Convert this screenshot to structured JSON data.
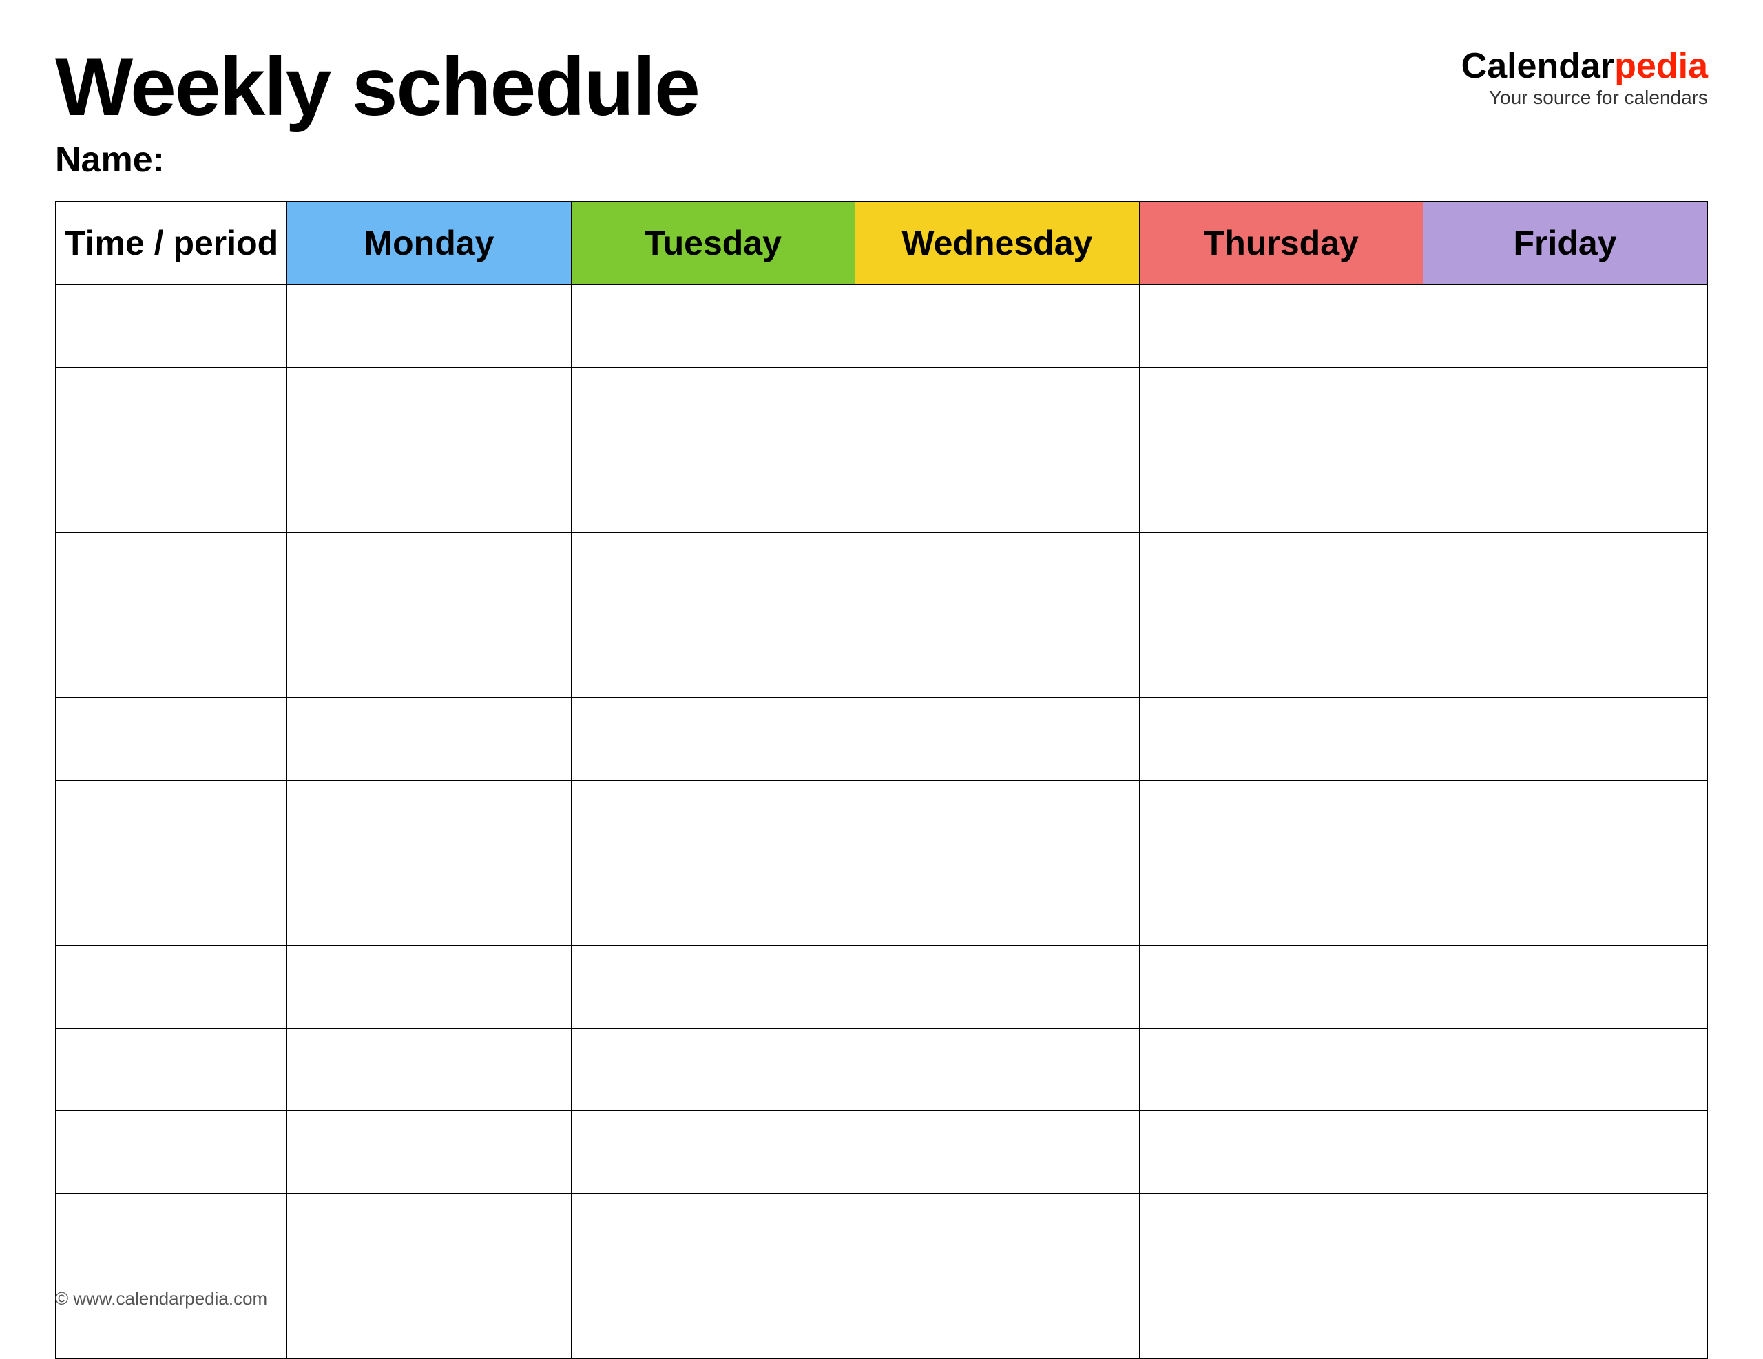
{
  "header": {
    "main_title": "Weekly schedule",
    "name_label": "Name:",
    "logo_calendar": "Calendar",
    "logo_pedia": "pedia",
    "logo_tagline": "Your source for calendars"
  },
  "table": {
    "columns": [
      {
        "id": "time",
        "label": "Time / period",
        "color": "#ffffff",
        "text_color": "#000000"
      },
      {
        "id": "monday",
        "label": "Monday",
        "color": "#6bb8f5",
        "text_color": "#000000"
      },
      {
        "id": "tuesday",
        "label": "Tuesday",
        "color": "#7ec832",
        "text_color": "#000000"
      },
      {
        "id": "wednesday",
        "label": "Wednesday",
        "color": "#f5d020",
        "text_color": "#000000"
      },
      {
        "id": "thursday",
        "label": "Thursday",
        "color": "#f07070",
        "text_color": "#000000"
      },
      {
        "id": "friday",
        "label": "Friday",
        "color": "#b39ddb",
        "text_color": "#000000"
      }
    ],
    "row_count": 13
  },
  "footer": {
    "url": "© www.calendarpedia.com"
  }
}
